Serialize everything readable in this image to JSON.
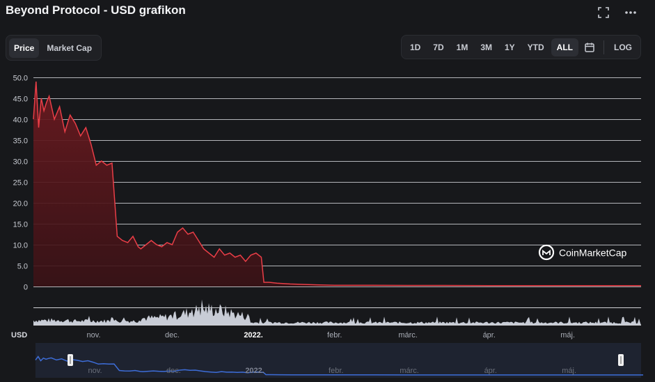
{
  "title": "Beyond Protocol - USD grafikon",
  "toolbar": {
    "fullscreen_icon": "fullscreen-icon",
    "more_icon": "more-horizontal-icon",
    "tabs": [
      "Price",
      "Market Cap"
    ],
    "active_tab": "Price",
    "ranges": [
      "1D",
      "7D",
      "1M",
      "3M",
      "1Y",
      "YTD",
      "ALL"
    ],
    "active_range": "ALL",
    "calendar_icon": "calendar-icon",
    "log_label": "LOG"
  },
  "watermark": "CoinMarketCap",
  "currency_label": "USD",
  "colors": {
    "line": "#e93e47",
    "fill_top": "#6b1a20",
    "volume": "#c8ccd6",
    "nav_line": "#3d6dd8",
    "grid": "#d0d2d6"
  },
  "chart_data": {
    "type": "area",
    "ylim": [
      0,
      50
    ],
    "yticks": [
      "50.0",
      "45.0",
      "40.0",
      "35.0",
      "30.0",
      "25.0",
      "20.0",
      "15.0",
      "10.0",
      "5.0",
      "0"
    ],
    "xtick_labels": [
      "nov.",
      "dec.",
      "2022.",
      "febr.",
      "márc.",
      "ápr.",
      "máj."
    ],
    "xtick_dates": [
      "2021-11-01",
      "2021-12-01",
      "2022-01-01",
      "2022-02-01",
      "2022-03-01",
      "2022-04-01",
      "2022-05-01"
    ],
    "x_start": "2021-10-09",
    "x_end": "2022-05-29",
    "series": [
      {
        "x": [
          "2021-10-09",
          "2021-10-10",
          "2021-10-11",
          "2021-10-12",
          "2021-10-13",
          "2021-10-14",
          "2021-10-15",
          "2021-10-17",
          "2021-10-19",
          "2021-10-21",
          "2021-10-23",
          "2021-10-25",
          "2021-10-27",
          "2021-10-29",
          "2021-10-31",
          "2021-11-02",
          "2021-11-04",
          "2021-11-06",
          "2021-11-08",
          "2021-11-10",
          "2021-11-12",
          "2021-11-14",
          "2021-11-16",
          "2021-11-18",
          "2021-11-19",
          "2021-11-21",
          "2021-11-23",
          "2021-11-25",
          "2021-11-27",
          "2021-11-29",
          "2021-12-01",
          "2021-12-03",
          "2021-12-05",
          "2021-12-07",
          "2021-12-09",
          "2021-12-11",
          "2021-12-13",
          "2021-12-15",
          "2021-12-17",
          "2021-12-19",
          "2021-12-21",
          "2021-12-23",
          "2021-12-25",
          "2021-12-27",
          "2021-12-29",
          "2021-12-31",
          "2022-01-02",
          "2022-01-04",
          "2022-01-05",
          "2022-01-07",
          "2022-01-10",
          "2022-01-15",
          "2022-01-20",
          "2022-01-25",
          "2022-02-01",
          "2022-02-15",
          "2022-03-01",
          "2022-03-15",
          "2022-04-01",
          "2022-04-15",
          "2022-05-01",
          "2022-05-15",
          "2022-05-29"
        ],
        "y": [
          40,
          49,
          38,
          45,
          42,
          44,
          45.5,
          40,
          43,
          37,
          41,
          39,
          36,
          38,
          34,
          29,
          30,
          29,
          29.5,
          12,
          11,
          10.5,
          12,
          9.5,
          9,
          10,
          11,
          10,
          9.5,
          10.5,
          10,
          13,
          14,
          12.5,
          13,
          11,
          9,
          8,
          7,
          9,
          7.5,
          8,
          7,
          7.5,
          6,
          7.5,
          8,
          7,
          1,
          1,
          0.8,
          0.6,
          0.5,
          0.4,
          0.3,
          0.3,
          0.25,
          0.25,
          0.2,
          0.2,
          0.2,
          0.2,
          0.2
        ]
      }
    ]
  }
}
